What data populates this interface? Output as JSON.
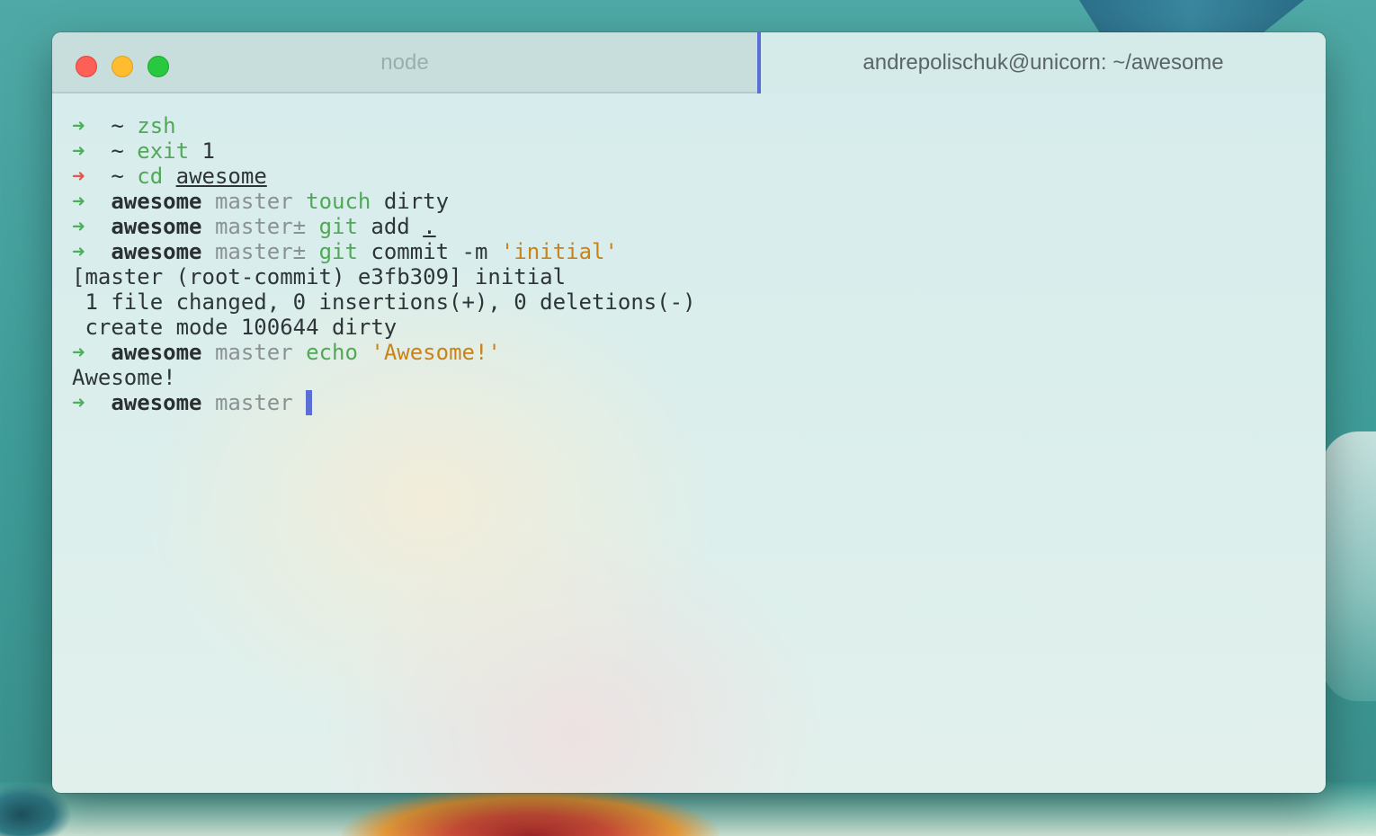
{
  "tabs": [
    {
      "title": "node",
      "active": false
    },
    {
      "title": "andrepolischuk@unicorn: ~/awesome",
      "active": true
    }
  ],
  "window_controls": [
    "close",
    "minimize",
    "maximize"
  ],
  "colors": {
    "accent": "#5a6fd6",
    "prompt_ok": "#4fae5c",
    "prompt_error": "#e0574f",
    "command": "#51a858",
    "string": "#c98317",
    "branch": "#8a9294"
  },
  "terminal": {
    "prompt_symbol": "➜",
    "lines": [
      {
        "prompt": "➜",
        "cwd": "~",
        "cmd": "zsh"
      },
      {
        "prompt": "➜",
        "cwd": "~",
        "cmd": "exit",
        "args": "1"
      },
      {
        "prompt": "➜",
        "cwd": "~",
        "cmd": "cd",
        "args": "awesome"
      },
      {
        "prompt": "➜",
        "cwd": "awesome",
        "branch": "master",
        "cmd": "touch",
        "args": "dirty"
      },
      {
        "prompt": "➜",
        "cwd": "awesome",
        "branch": "master±",
        "cmd": "git",
        "args": "add",
        "path": "."
      },
      {
        "prompt": "➜",
        "cwd": "awesome",
        "branch": "master±",
        "cmd": "git",
        "args": "commit -m",
        "string": "'initial'"
      },
      {
        "output": "[master (root-commit) e3fb309] initial"
      },
      {
        "output": " 1 file changed, 0 insertions(+), 0 deletions(-)"
      },
      {
        "output": " create mode 100644 dirty"
      },
      {
        "prompt": "➜",
        "cwd": "awesome",
        "branch": "master",
        "cmd": "echo",
        "string": "'Awesome!'"
      },
      {
        "output": "Awesome!"
      },
      {
        "prompt": "➜",
        "cwd": "awesome",
        "branch": "master"
      }
    ]
  }
}
